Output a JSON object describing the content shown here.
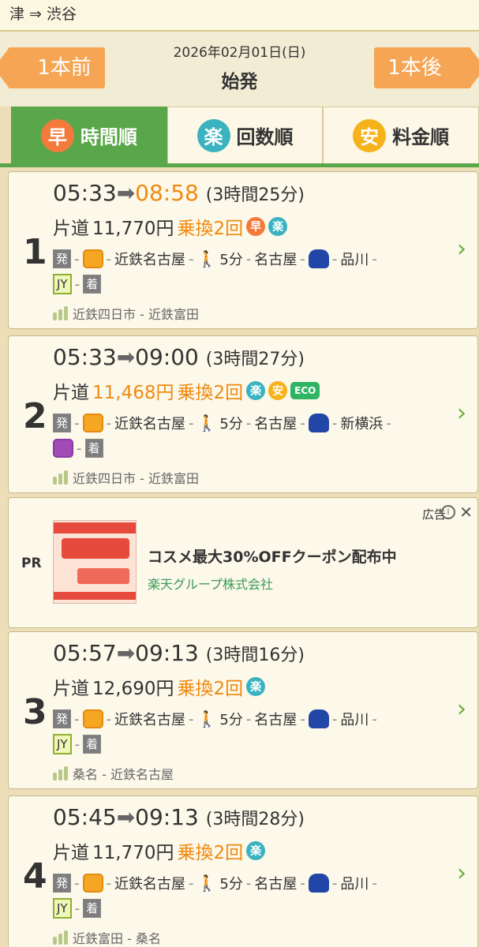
{
  "route": "津 ⇒ 渋谷",
  "header": {
    "prev_label": "1本前",
    "next_label": "1本後",
    "date": "2026年02月01日(日)",
    "subtitle": "始発"
  },
  "tabs": [
    {
      "icon": "早",
      "label": "時間順",
      "active": true
    },
    {
      "icon": "楽",
      "label": "回数順",
      "active": false
    },
    {
      "icon": "安",
      "label": "料金順",
      "active": false
    }
  ],
  "results": [
    {
      "number": "1",
      "depart": "05:33",
      "arrive": "08:58",
      "duration": "(3時間25分)",
      "fare_prefix": "片道",
      "fare": "11,770円",
      "transfers": "乗換2回",
      "badges": [
        "早",
        "楽"
      ],
      "segments": [
        "発",
        "近鉄名古屋",
        "5分",
        "名古屋",
        "品川",
        "JY",
        "着"
      ],
      "line_info": "近鉄四日市 - 近鉄富田"
    },
    {
      "number": "2",
      "depart": "05:33",
      "arrive": "09:00",
      "duration": "(3時間27分)",
      "fare_prefix": "片道",
      "fare": "11,468円",
      "transfers": "乗換2回",
      "badges": [
        "楽",
        "安",
        "ECO"
      ],
      "segments": [
        "発",
        "近鉄名古屋",
        "5分",
        "名古屋",
        "新横浜",
        "着"
      ],
      "line_info": "近鉄四日市 - 近鉄富田"
    },
    {
      "number": "3",
      "depart": "05:57",
      "arrive": "09:13",
      "duration": "(3時間16分)",
      "fare_prefix": "片道",
      "fare": "12,690円",
      "transfers": "乗換2回",
      "badges": [
        "楽"
      ],
      "segments": [
        "発",
        "近鉄名古屋",
        "5分",
        "名古屋",
        "品川",
        "JY",
        "着"
      ],
      "line_info": "桑名 - 近鉄名古屋"
    },
    {
      "number": "4",
      "depart": "05:45",
      "arrive": "09:13",
      "duration": "(3時間28分)",
      "fare_prefix": "片道",
      "fare": "11,770円",
      "transfers": "乗換2回",
      "badges": [
        "楽"
      ],
      "segments": [
        "発",
        "近鉄名古屋",
        "5分",
        "名古屋",
        "品川",
        "JY",
        "着"
      ],
      "line_info": "近鉄富田 - 桑名"
    }
  ],
  "ad": {
    "pr": "PR",
    "label": "広告",
    "headline": "コスメ最大30%OFFクーポン配布中",
    "advertiser": "楽天グループ株式会社"
  },
  "colors": {
    "orange": "#f08a10",
    "green": "#5aa64a",
    "raku": "#3ab2bf",
    "haya": "#f47a3c",
    "yasu": "#f5b21a"
  }
}
